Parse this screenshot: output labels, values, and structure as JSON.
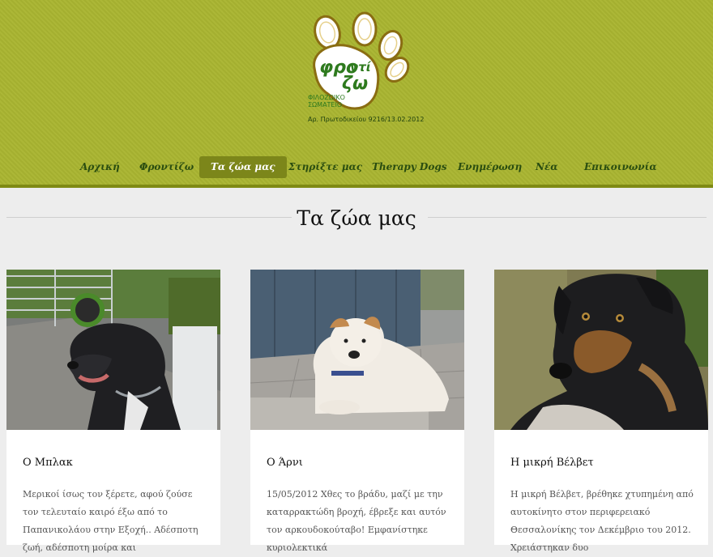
{
  "brand": {
    "logo_text_top": "φρο",
    "logo_text_mid": "ντί",
    "logo_text_bottom": "ζω",
    "logo_subtitle_1": "ΦΙΛΟΖΩΙΚΟ",
    "logo_subtitle_2": "ΣΩΜΑΤΕΙΟ",
    "registration": "Αρ. Πρωτοδικείου 9216/13.02.2012"
  },
  "nav": {
    "items": [
      "Αρχική",
      "Φροντίζω",
      "Τα ζώα μας",
      "Στηρίξτε μας",
      "Therapy Dogs",
      "Ενημέρωση",
      "Νέα",
      "Επικοινωνία"
    ],
    "active": "Τα ζώα μας"
  },
  "page": {
    "title": "Τα ζώα μας"
  },
  "cards": [
    {
      "name": "Ο Μπλακ",
      "excerpt": "Μερικοί ίσως τον ξέρετε, αφού ζούσε τον τελευταίο καιρό έξω από το Παπανικολάου στην Εξοχή.. Αδέσποτη ζωή, αδέσποτη μοίρα και"
    },
    {
      "name": "Ο Άρνι",
      "excerpt": "15/05/2012 Χθες το βράδυ, μαζί με την καταρρακτώδη βροχή, έβρεξε και αυτόν τον αρκουδοκούταβο! Εμφανίστηκε κυριολεκτικά"
    },
    {
      "name": "Η μικρή Βέλβετ",
      "excerpt": "Η μικρή Βέλβετ, βρέθηκε χτυπημένη από αυτοκίνητο στον περιφερειακό Θεσσαλονίκης τον Δεκέμβριο του 2012. Χρειάστηκαν δυο"
    }
  ],
  "colors": {
    "header_bg": "#a9b531",
    "nav_active_bg": "#7c861a",
    "nav_text": "#2a4d10"
  }
}
